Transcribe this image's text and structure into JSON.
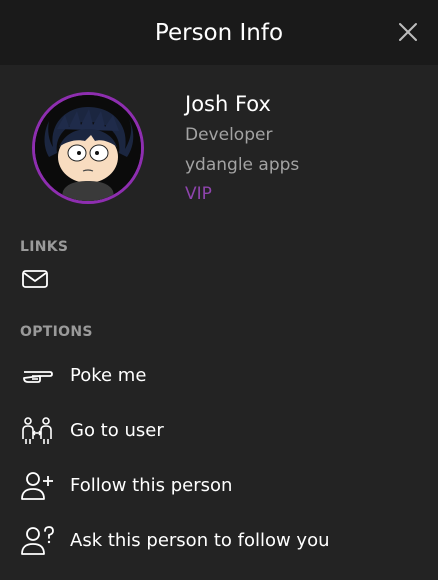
{
  "header": {
    "title": "Person Info",
    "close_icon": "close-icon"
  },
  "profile": {
    "name": "Josh Fox",
    "role": "Developer",
    "organization": "ydangle apps",
    "badge": "VIP",
    "badge_color": "#8e44ad",
    "avatar_ring_color": "#8e2eb0"
  },
  "links": {
    "label": "LINKS",
    "items": [
      {
        "icon": "mail-icon"
      }
    ]
  },
  "options": {
    "label": "OPTIONS",
    "items": [
      {
        "label": "Poke me",
        "icon": "pointing-hand-icon"
      },
      {
        "label": "Go to user",
        "icon": "people-connect-icon"
      },
      {
        "label": "Follow this person",
        "icon": "user-plus-icon"
      },
      {
        "label": "Ask this person to follow you",
        "icon": "user-question-icon"
      }
    ]
  }
}
